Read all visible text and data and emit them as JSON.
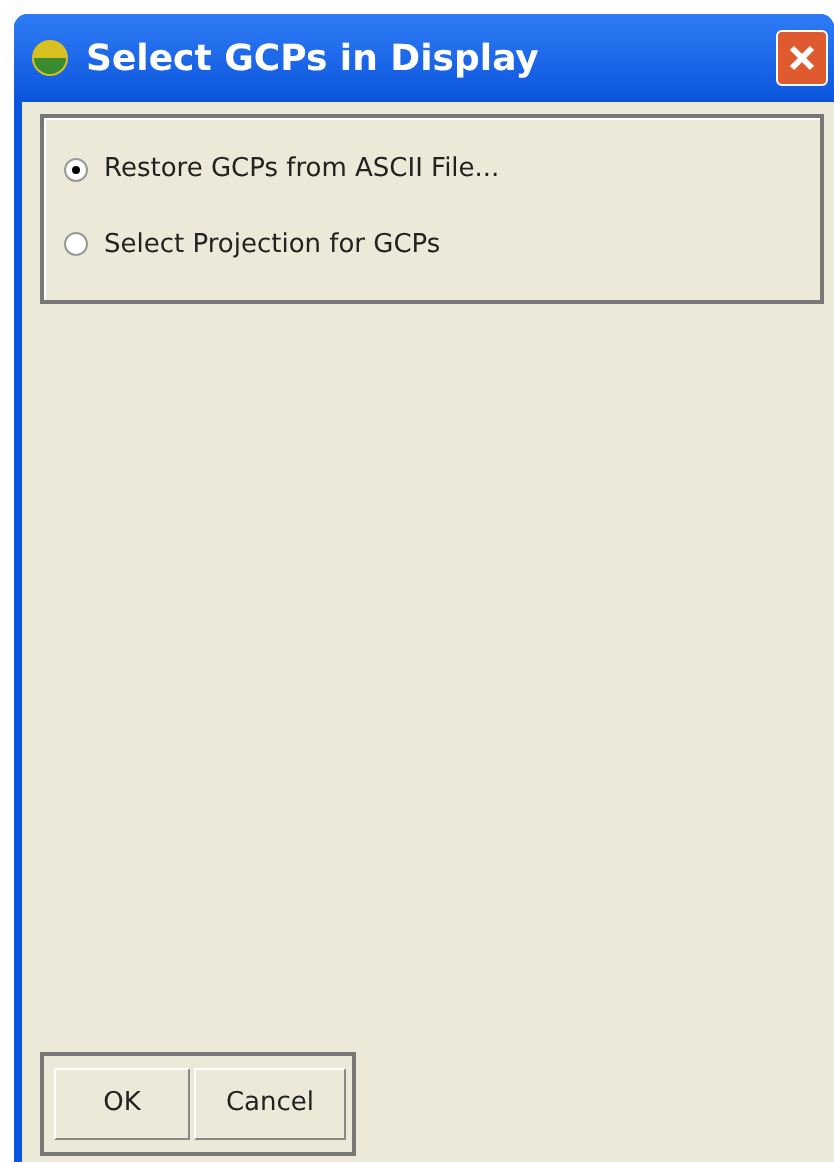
{
  "window": {
    "title": "Select GCPs in Display"
  },
  "options": [
    {
      "label": "Restore GCPs from ASCII File...",
      "selected": true
    },
    {
      "label": "Select Projection for GCPs",
      "selected": false
    }
  ],
  "buttons": [
    "OK",
    "Cancel"
  ]
}
